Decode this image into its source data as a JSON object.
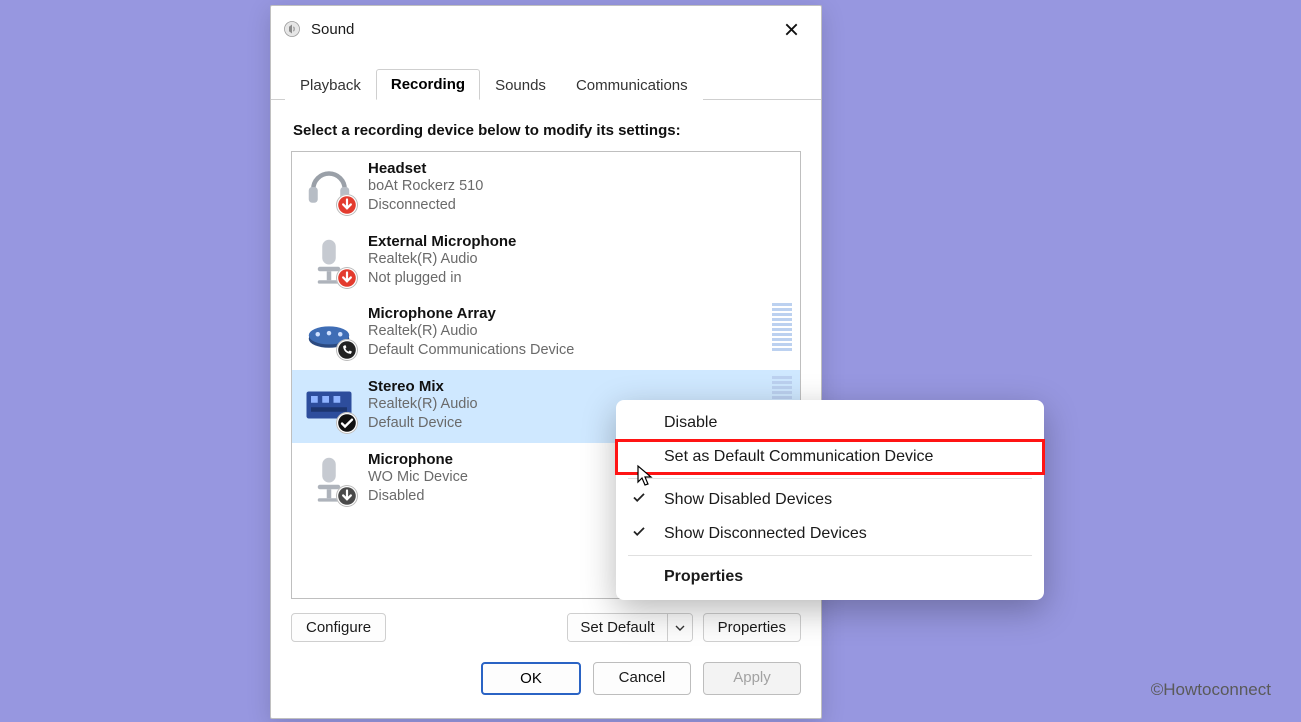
{
  "window": {
    "title": "Sound"
  },
  "tabs": {
    "playback": "Playback",
    "recording": "Recording",
    "sounds": "Sounds",
    "communications": "Communications",
    "active": "Recording"
  },
  "instruction": "Select a recording device below to modify its settings:",
  "devices": [
    {
      "name": "Headset",
      "sub": "boAt Rockerz 510",
      "status": "Disconnected",
      "icon": "headset",
      "badge": "down-red",
      "selected": false,
      "meter": false
    },
    {
      "name": "External Microphone",
      "sub": "Realtek(R) Audio",
      "status": "Not plugged in",
      "icon": "mic",
      "badge": "down-red",
      "selected": false,
      "meter": false
    },
    {
      "name": "Microphone Array",
      "sub": "Realtek(R) Audio",
      "status": "Default Communications Device",
      "icon": "micarray",
      "badge": "phone",
      "selected": false,
      "meter": true
    },
    {
      "name": "Stereo Mix",
      "sub": "Realtek(R) Audio",
      "status": "Default Device",
      "icon": "stereomix",
      "badge": "check",
      "selected": true,
      "meter": true
    },
    {
      "name": "Microphone",
      "sub": "WO Mic Device",
      "status": "Disabled",
      "icon": "mic",
      "badge": "down-grey",
      "selected": false,
      "meter": false
    }
  ],
  "buttons": {
    "configure": "Configure",
    "set_default": "Set Default",
    "properties": "Properties",
    "ok": "OK",
    "cancel": "Cancel",
    "apply": "Apply"
  },
  "context_menu": {
    "disable": "Disable",
    "set_default_comm": "Set as Default Communication Device",
    "show_disabled": "Show Disabled Devices",
    "show_disconnected": "Show Disconnected Devices",
    "properties": "Properties",
    "checked": {
      "show_disabled": true,
      "show_disconnected": true
    },
    "highlighted": "set_default_comm"
  },
  "watermark": "©Howtoconnect"
}
